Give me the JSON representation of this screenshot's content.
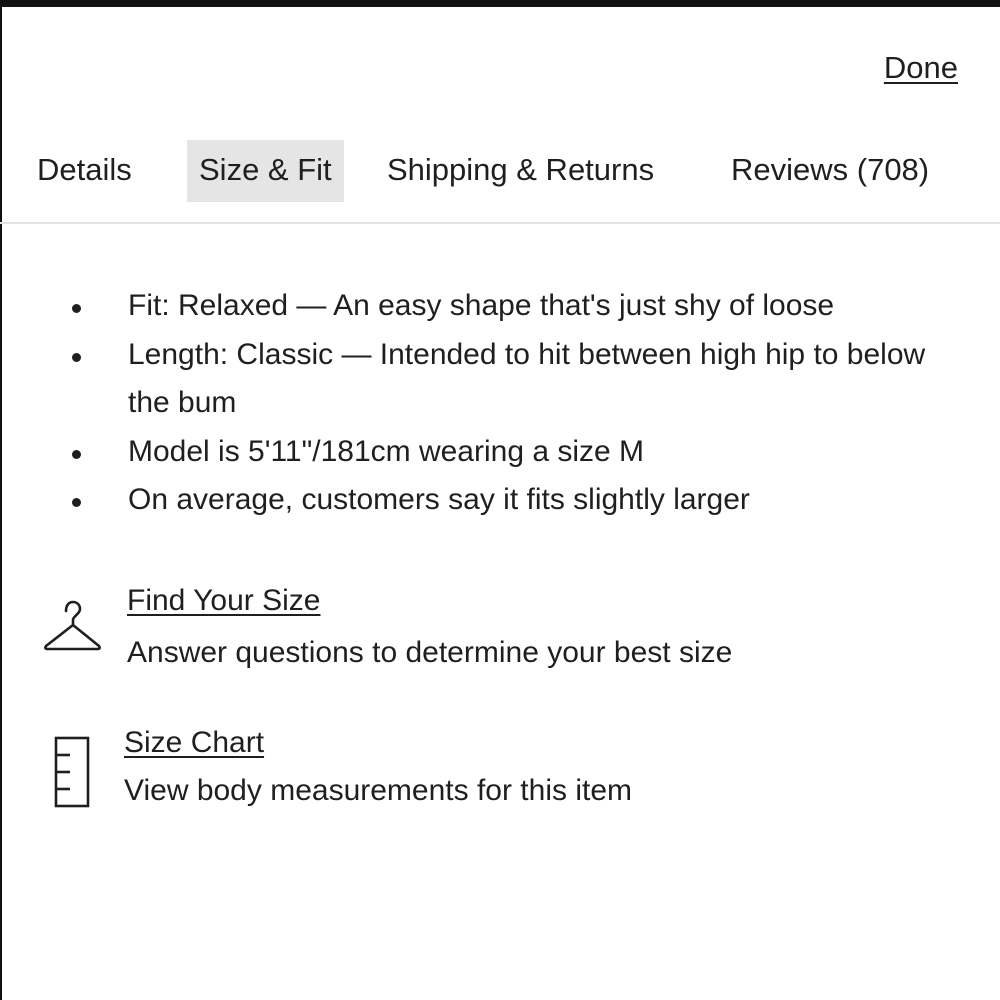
{
  "header": {
    "done_label": "Done"
  },
  "tabs": [
    {
      "label": "Details",
      "active": false
    },
    {
      "label": "Size & Fit",
      "active": true
    },
    {
      "label": "Shipping & Returns",
      "active": false
    },
    {
      "label": "Reviews (708)",
      "active": false
    }
  ],
  "size_fit": {
    "bullets": [
      "Fit: Relaxed — An easy shape that's just shy of loose",
      "Length: Classic — Intended to hit between high hip to below the bum",
      "Model is 5'11\"/181cm wearing a size M",
      "On average, customers say it fits slightly larger"
    ],
    "find_your_size": {
      "icon": "hanger-icon",
      "link": "Find Your Size",
      "description": "Answer questions to determine your best size"
    },
    "size_chart": {
      "icon": "ruler-icon",
      "link": "Size Chart",
      "description": "View body measurements for this item"
    }
  },
  "colors": {
    "text": "#1f1f1f",
    "active_tab_bg": "#e5e5e5",
    "divider": "#e3e3e3"
  }
}
